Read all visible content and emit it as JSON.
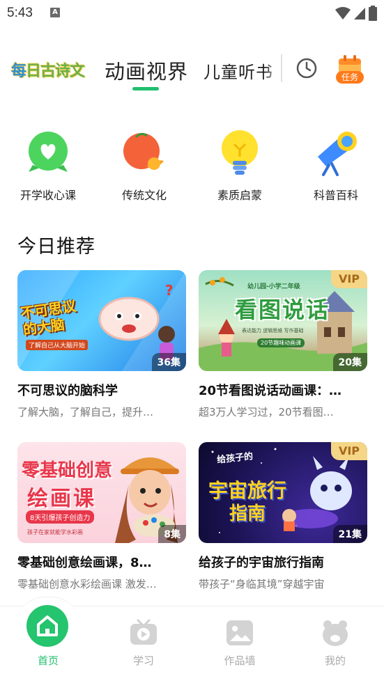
{
  "status_bar": {
    "time": "5:43",
    "notification_letter": "A"
  },
  "top_tabs": {
    "logo_text": "每日古诗文",
    "logo_first_char": "每",
    "logo_rest": "日古诗文",
    "active_tab": "动画视界",
    "next_tab": "儿童听书",
    "task_label": "任务"
  },
  "categories": [
    {
      "label": "开学收心课",
      "icon": "heart-icon"
    },
    {
      "label": "传统文化",
      "icon": "orange-fruit-icon"
    },
    {
      "label": "素质启蒙",
      "icon": "lightbulb-icon"
    },
    {
      "label": "科普百科",
      "icon": "telescope-icon"
    }
  ],
  "section": {
    "title": "今日推荐"
  },
  "cards": [
    {
      "title": "不可思议的脑科学",
      "desc": "了解大脑，了解自己，提升…",
      "count": "36集",
      "vip": "",
      "thumb_text": "不可思议的大脑",
      "thumb_sub": "了解自己从大脑开始"
    },
    {
      "title": "20节看图说话动画课：…",
      "desc": "超3万人学习过，20节看图…",
      "count": "20集",
      "vip": "VIP",
      "thumb_text": "看图说话",
      "thumb_sub": "20节趣味动画课",
      "thumb_top": "幼儿园-小学二年级",
      "thumb_tags": "表达能力  逻辑思维  写作基础"
    },
    {
      "title": "零基础创意绘画课，8…",
      "desc": "零基础创意水彩绘画课 激发…",
      "count": "8集",
      "vip": "",
      "thumb_text1": "零基础创意",
      "thumb_text2": "绘画课",
      "thumb_sub": "8天引爆孩子创造力",
      "thumb_sub2": "孩子在家就能学水彩画"
    },
    {
      "title": "给孩子的宇宙旅行指南",
      "desc": "带孩子“身临其境”穿越宇宙",
      "count": "21集",
      "vip": "VIP",
      "thumb_text1": "给孩子的",
      "thumb_text2": "宇宙旅行",
      "thumb_text3": "指南"
    }
  ],
  "bottom_nav": [
    {
      "label": "首页",
      "icon": "home-icon",
      "active": true
    },
    {
      "label": "学习",
      "icon": "tv-play-icon",
      "active": false
    },
    {
      "label": "作品墙",
      "icon": "picture-icon",
      "active": false
    },
    {
      "label": "我的",
      "icon": "bear-face-icon",
      "active": false
    }
  ],
  "colors": {
    "accent": "#1fbf6d",
    "task_orange": "#ff7a1a",
    "vip_gold": "#f5d586"
  }
}
